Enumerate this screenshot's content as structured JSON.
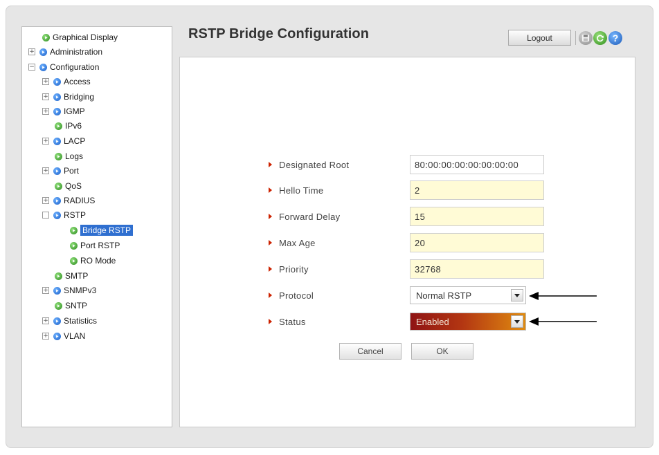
{
  "header": {
    "title": "RSTP Bridge Configuration",
    "logout_label": "Logout",
    "help_glyph": "?"
  },
  "sidebar": {
    "items": [
      {
        "label": "Graphical Display",
        "expander": "",
        "icon": "green"
      },
      {
        "label": "Administration",
        "expander": "+",
        "icon": "blue"
      },
      {
        "label": "Configuration",
        "expander": "−",
        "icon": "blue"
      },
      {
        "label": "Access",
        "expander": "+",
        "icon": "blue"
      },
      {
        "label": "Bridging",
        "expander": "+",
        "icon": "blue"
      },
      {
        "label": "IGMP",
        "expander": "+",
        "icon": "blue"
      },
      {
        "label": "IPv6",
        "expander": "",
        "icon": "green"
      },
      {
        "label": "LACP",
        "expander": "+",
        "icon": "blue"
      },
      {
        "label": "Logs",
        "expander": "",
        "icon": "green"
      },
      {
        "label": "Port",
        "expander": "+",
        "icon": "blue"
      },
      {
        "label": "QoS",
        "expander": "",
        "icon": "green"
      },
      {
        "label": "RADIUS",
        "expander": "+",
        "icon": "blue"
      },
      {
        "label": "RSTP",
        "expander": " ",
        "icon": "blue"
      },
      {
        "label": "Bridge RSTP",
        "expander": "",
        "icon": "green"
      },
      {
        "label": "Port RSTP",
        "expander": "",
        "icon": "green"
      },
      {
        "label": "RO Mode",
        "expander": "",
        "icon": "green"
      },
      {
        "label": "SMTP",
        "expander": "",
        "icon": "green"
      },
      {
        "label": "SNMPv3",
        "expander": "+",
        "icon": "blue"
      },
      {
        "label": "SNTP",
        "expander": "",
        "icon": "green"
      },
      {
        "label": "Statistics",
        "expander": "+",
        "icon": "blue"
      },
      {
        "label": "VLAN",
        "expander": "+",
        "icon": "blue"
      }
    ]
  },
  "form": {
    "designated_root": {
      "label": "Designated Root",
      "value": "80:00:00:00:00:00:00:00"
    },
    "hello_time": {
      "label": "Hello Time",
      "value": "2"
    },
    "forward_delay": {
      "label": "Forward Delay",
      "value": "15"
    },
    "max_age": {
      "label": "Max Age",
      "value": "20"
    },
    "priority": {
      "label": "Priority",
      "value": "32768"
    },
    "protocol": {
      "label": "Protocol",
      "value": "Normal RSTP"
    },
    "status": {
      "label": "Status",
      "value": "Enabled"
    }
  },
  "buttons": {
    "cancel_label": "Cancel",
    "ok_label": "OK"
  },
  "colors": {
    "selected": "#2f6fd0",
    "input_bg": "#fffbd6",
    "bullet": "#cc2200"
  }
}
